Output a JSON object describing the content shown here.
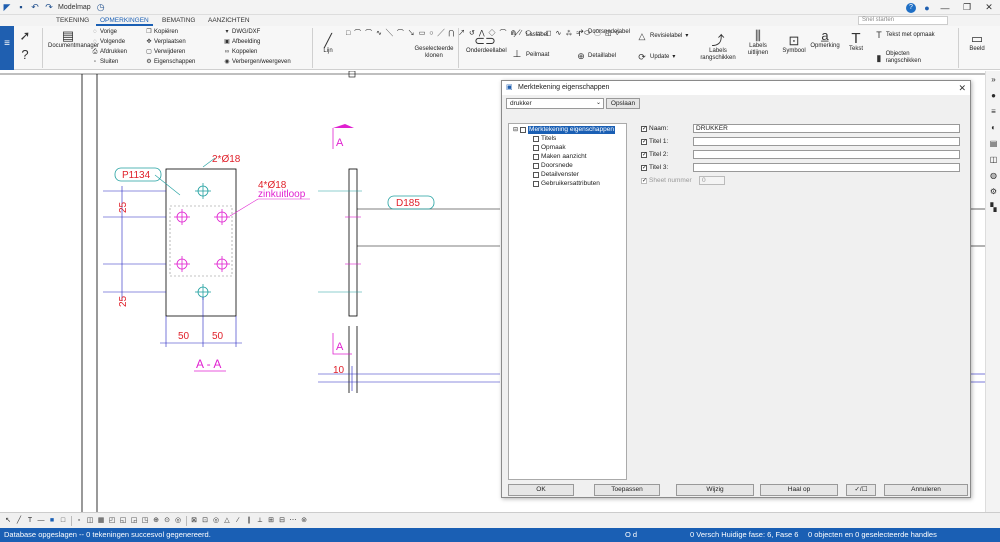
{
  "titlebar": {
    "app_title": "Modelmap",
    "close_glyph": "✕",
    "minimize_glyph": "—",
    "restore_glyph": "❐"
  },
  "tabs": [
    {
      "label": "TEKENING",
      "active": false
    },
    {
      "label": "OPMERKINGEN",
      "active": true
    },
    {
      "label": "BEMATING",
      "active": false
    },
    {
      "label": "AANZICHTEN",
      "active": false
    }
  ],
  "search": {
    "placeholder": "Snel starten"
  },
  "ribbon": {
    "documentmanager": "Documentmanager",
    "vorige": "Vorige",
    "volgende": "Volgende",
    "afdrukken": "Afdrukken",
    "sluiten": "Sluiten",
    "kopieren": "Kopiëren",
    "verplaatsen": "Verplaatsen",
    "verwijderen": "Verwijderen",
    "eigenschappen": "Eigenschappen",
    "dwg": "DWG/DXF",
    "afbeelding": "Afbeelding",
    "koppelen": "Koppelen",
    "verbergen": "Verbergen/weergeven",
    "lijn": "Lijn",
    "geselecteerde_klonen": "Geselecteerde klonen",
    "onderdeellabel": "Onderdeellabel",
    "laslabel": "Laslabel",
    "peilmaat": "Peilmaat",
    "doorsnedelabel": "Doorsnedelabel",
    "detaillabel": "Detaillabel",
    "revisielabel": "Revisielabel",
    "update": "Update",
    "labels_rangschikken": "Labels rangschikken",
    "labels_uitlijnen": "Labels uitlijnen",
    "symbool": "Symbool",
    "opmerking": "Opmerking",
    "tekst": "Tekst",
    "tekst_met_opmaak": "Tekst met opmaak",
    "objecten_rangschikken": "Objecten rangschikken",
    "beeld": "Beeld"
  },
  "drawing": {
    "label_p1134": "P1134",
    "label_2d18": "2*Ø18",
    "label_4d18": "4*Ø18",
    "label_zinkuitloop": "zinkuitloop",
    "dim_25_top": "25",
    "dim_25_bottom": "25",
    "dim_50_left": "50",
    "dim_50_right": "50",
    "section_title": "A - A",
    "label_d185": "D185",
    "section_marker_top": "A",
    "section_marker_bottom": "A",
    "dim_10": "10",
    "colors": {
      "magenta": "#e020d0",
      "red": "#e0202a",
      "cyan": "#20a0a0",
      "blue": "#2020c0"
    }
  },
  "dialog": {
    "title": "Merktekening eigenschappen",
    "preset": "drukker",
    "opslaan": "Opslaan",
    "tree": {
      "root": "Merktekening eigenschappen",
      "children": [
        "Titels",
        "Opmaak",
        "Maken aanzicht",
        "Doorsnede",
        "Detailvenster",
        "Gebruikersattributen"
      ]
    },
    "fields": {
      "naam_label": "Naam:",
      "naam_value": "DRUKKER",
      "titel1_label": "Titel 1:",
      "titel1_value": "",
      "titel2_label": "Titel 2:",
      "titel2_value": "",
      "titel3_label": "Titel 3:",
      "titel3_value": "",
      "sheet_label": "Sheet nummer",
      "sheet_value": "0"
    },
    "buttons": {
      "ok": "OK",
      "toepassen": "Toepassen",
      "wijzig": "Wijzig",
      "haal_op": "Haal op",
      "toggle": "✓/☐",
      "annuleren": "Annuleren"
    }
  },
  "status": {
    "left": "Database opgeslagen -- 0 tekeningen succesvol gegenereerd.",
    "mode": "O d",
    "phase": "0 Versch Huidige fase: 6, Fase 6",
    "selection": "0 objecten en 0 geselecteerde handles"
  }
}
